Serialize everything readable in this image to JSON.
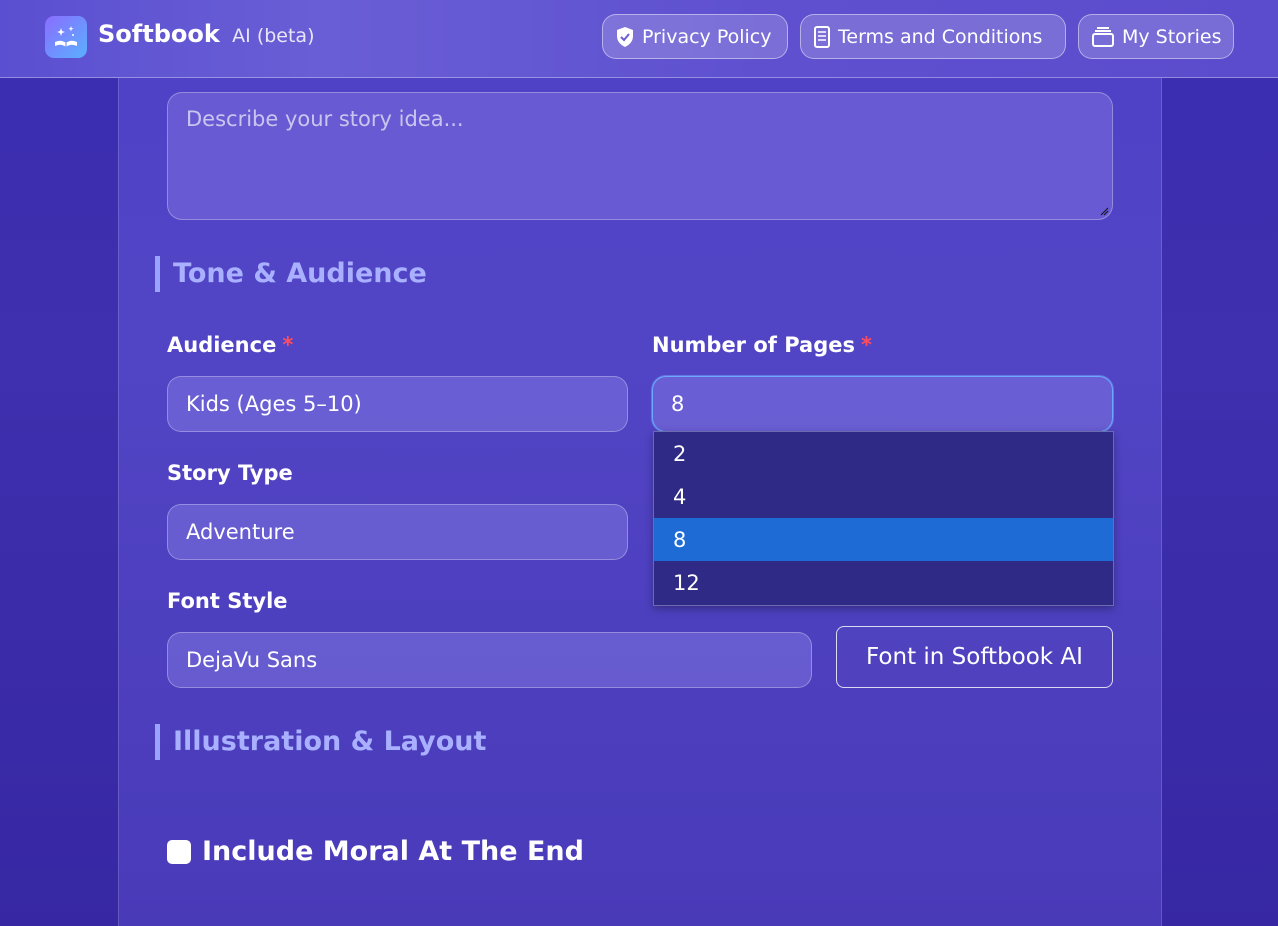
{
  "header": {
    "brand": "Softbook",
    "brand_sub": "AI (beta)",
    "nav": [
      {
        "label": "Privacy Policy",
        "icon": "shield-icon"
      },
      {
        "label": "Terms and Conditions",
        "icon": "document-icon"
      },
      {
        "label": "My Stories",
        "icon": "stack-icon"
      }
    ]
  },
  "form": {
    "story_idea_placeholder": "Describe your story idea...",
    "sections": {
      "tone": "Tone & Audience",
      "illustration": "Illustration & Layout"
    },
    "audience": {
      "label": "Audience",
      "required": "*",
      "value": "Kids (Ages 5–10)"
    },
    "pages": {
      "label": "Number of Pages",
      "required": "*",
      "value": "8",
      "options": [
        "2",
        "4",
        "8",
        "12"
      ],
      "selected": "8"
    },
    "story_type": {
      "label": "Story Type",
      "value": "Adventure"
    },
    "font_style": {
      "label": "Font Style",
      "value": "DejaVu Sans",
      "button": "Font in Softbook AI"
    },
    "moral": {
      "label": "Include Moral At The End",
      "checked": false
    }
  },
  "colors": {
    "accent": "#a9b0ff",
    "required": "#ff4d5e",
    "selected_option": "#1e6bd6"
  }
}
